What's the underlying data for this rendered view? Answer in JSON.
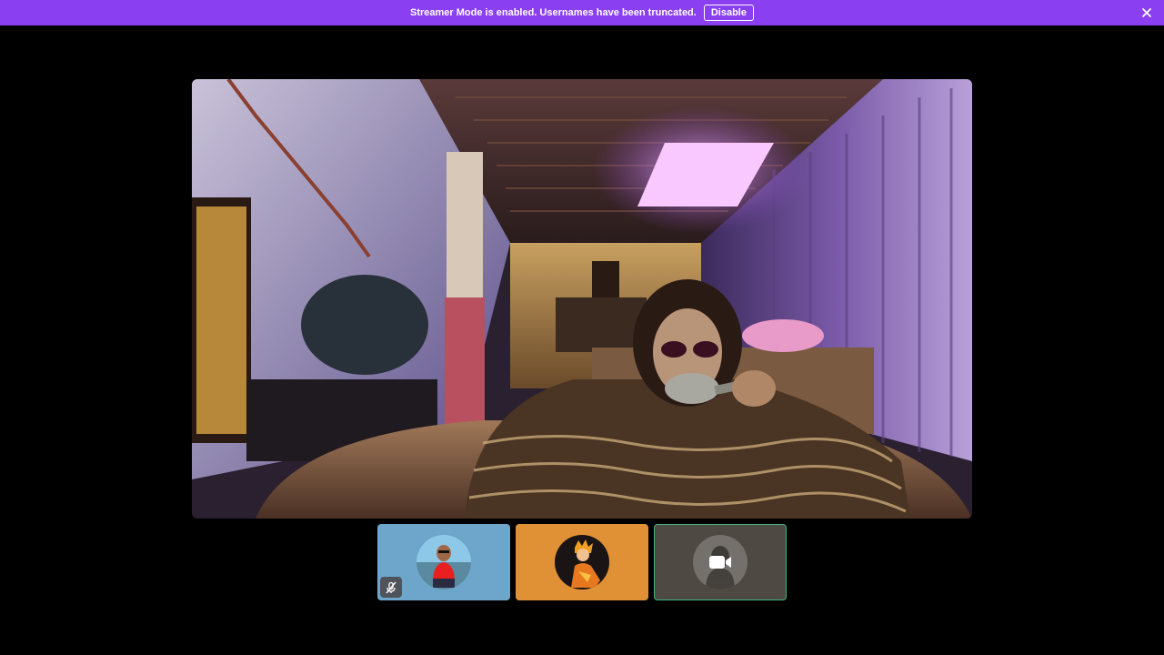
{
  "banner": {
    "message": "Streamer Mode is enabled. Usernames have been truncated.",
    "disable_label": "Disable",
    "close_icon": "close-icon",
    "color": "#8a3ff0"
  },
  "main_stream": {
    "type": "camera-video",
    "scene": "person in patterned sweater sitting on couch holding a hairbrush, purple-lit room"
  },
  "participants": [
    {
      "avatar_type": "photo",
      "muted": true,
      "mute_icon": "mic-muted-icon",
      "tile_color": "#6ea6cb"
    },
    {
      "avatar_type": "illustration",
      "muted": false,
      "tile_color": "#e09035"
    },
    {
      "avatar_type": "camera-off",
      "camera_icon": "video-camera-icon",
      "speaking": true,
      "tile_color": "#4f4943",
      "speaking_color": "#43b581"
    }
  ]
}
